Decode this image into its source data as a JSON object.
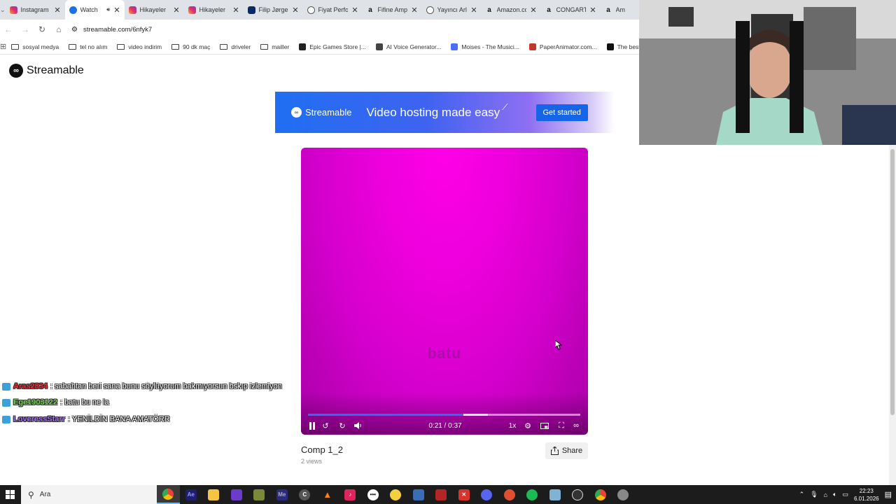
{
  "browser": {
    "tabs": [
      {
        "title": "Instagram",
        "icon": "instagram-icon",
        "active": false
      },
      {
        "title": "Watch",
        "icon": "streamable-icon",
        "active": true
      },
      {
        "title": "Hikayeler",
        "icon": "instagram-icon",
        "active": false
      },
      {
        "title": "Hikayeler",
        "icon": "instagram-icon",
        "active": false
      },
      {
        "title": "Filip Jørge",
        "icon": "site-icon",
        "active": false
      },
      {
        "title": "Fiyat Perfo",
        "icon": "globe-icon",
        "active": false
      },
      {
        "title": "Fifine Amp",
        "icon": "amazon-icon",
        "active": false
      },
      {
        "title": "Yayıncı Arl",
        "icon": "globe-icon",
        "active": false
      },
      {
        "title": "Amazon.co",
        "icon": "amazon-icon",
        "active": false
      },
      {
        "title": "CONGART",
        "icon": "amazon-icon",
        "active": false
      },
      {
        "title": "Am",
        "icon": "amazon-icon",
        "active": false
      }
    ],
    "url": "streamable.com/6nfyk7",
    "bookmarks": [
      {
        "label": "sosyal medya",
        "type": "folder"
      },
      {
        "label": "tel no alım",
        "type": "folder"
      },
      {
        "label": "video indirim",
        "type": "folder"
      },
      {
        "label": "90 dk maç",
        "type": "folder"
      },
      {
        "label": "driveler",
        "type": "folder"
      },
      {
        "label": "mailler",
        "type": "folder"
      },
      {
        "label": "Epic Games Store |...",
        "type": "link"
      },
      {
        "label": "AI Voice Generator...",
        "type": "link"
      },
      {
        "label": "Moises - The Musici...",
        "type": "link"
      },
      {
        "label": "PaperAnimator.com...",
        "type": "link"
      },
      {
        "label": "The best ChatBot",
        "type": "link"
      }
    ]
  },
  "page": {
    "logo": "Streamable",
    "banner": {
      "brand": "Streamable",
      "headline": "Video hosting made easy",
      "cta": "Get started"
    },
    "video": {
      "overlay_text": "batu",
      "time": "0:21 / 0:37",
      "progress": 0.57,
      "speed": "1x",
      "title": "Comp 1_2",
      "views": "2 views",
      "share": "Share"
    }
  },
  "chat": [
    {
      "user": "Aras2834",
      "message": ": sabahtan beri sana bunu söylüyorum bakmıyorsun bskıp izlemiyon",
      "color": "#e8323c"
    },
    {
      "user": "Ege1903122",
      "message": ": batu bu ne la",
      "color": "#7ed957"
    },
    {
      "user": "LoveressStarr",
      "message": ": YENİLDİN BANA AMATÖRR",
      "color": "#a070e8"
    }
  ],
  "taskbar": {
    "search_placeholder": "Ara",
    "time": "22:23",
    "date": "6.01.2026"
  }
}
